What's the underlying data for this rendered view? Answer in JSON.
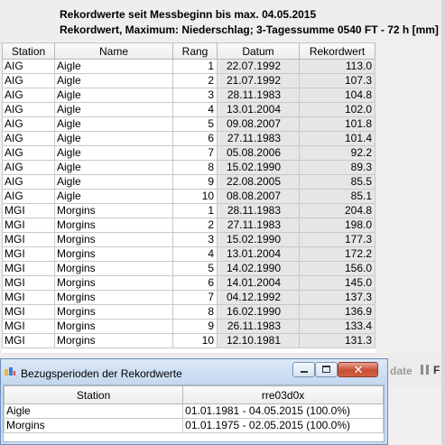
{
  "main": {
    "title": "Rekordwerte seit Messbeginn bis max. 04.05.2015",
    "subtitle": "Rekordwert, Maximum: Niederschlag; 3-Tagessumme 0540 FT - 72 h [mm]",
    "columns": [
      "Station",
      "Name",
      "Rang",
      "Datum",
      "Rekordwert"
    ],
    "rows": [
      {
        "station": "AIG",
        "name": "Aigle",
        "rank": "1",
        "date": "22.07.1992",
        "value": "113.0"
      },
      {
        "station": "AIG",
        "name": "Aigle",
        "rank": "2",
        "date": "21.07.1992",
        "value": "107.3"
      },
      {
        "station": "AIG",
        "name": "Aigle",
        "rank": "3",
        "date": "28.11.1983",
        "value": "104.8"
      },
      {
        "station": "AIG",
        "name": "Aigle",
        "rank": "4",
        "date": "13.01.2004",
        "value": "102.0"
      },
      {
        "station": "AIG",
        "name": "Aigle",
        "rank": "5",
        "date": "09.08.2007",
        "value": "101.8"
      },
      {
        "station": "AIG",
        "name": "Aigle",
        "rank": "6",
        "date": "27.11.1983",
        "value": "101.4"
      },
      {
        "station": "AIG",
        "name": "Aigle",
        "rank": "7",
        "date": "05.08.2006",
        "value": "92.2"
      },
      {
        "station": "AIG",
        "name": "Aigle",
        "rank": "8",
        "date": "15.02.1990",
        "value": "89.3"
      },
      {
        "station": "AIG",
        "name": "Aigle",
        "rank": "9",
        "date": "22.08.2005",
        "value": "85.5"
      },
      {
        "station": "AIG",
        "name": "Aigle",
        "rank": "10",
        "date": "08.08.2007",
        "value": "85.1"
      },
      {
        "station": "MGI",
        "name": "Morgins",
        "rank": "1",
        "date": "28.11.1983",
        "value": "204.8"
      },
      {
        "station": "MGI",
        "name": "Morgins",
        "rank": "2",
        "date": "27.11.1983",
        "value": "198.0"
      },
      {
        "station": "MGI",
        "name": "Morgins",
        "rank": "3",
        "date": "15.02.1990",
        "value": "177.3"
      },
      {
        "station": "MGI",
        "name": "Morgins",
        "rank": "4",
        "date": "13.01.2004",
        "value": "172.2"
      },
      {
        "station": "MGI",
        "name": "Morgins",
        "rank": "5",
        "date": "14.02.1990",
        "value": "156.0"
      },
      {
        "station": "MGI",
        "name": "Morgins",
        "rank": "6",
        "date": "14.01.2004",
        "value": "145.0"
      },
      {
        "station": "MGI",
        "name": "Morgins",
        "rank": "7",
        "date": "04.12.1992",
        "value": "137.3"
      },
      {
        "station": "MGI",
        "name": "Morgins",
        "rank": "8",
        "date": "16.02.1990",
        "value": "136.9"
      },
      {
        "station": "MGI",
        "name": "Morgins",
        "rank": "9",
        "date": "26.11.1983",
        "value": "133.4"
      },
      {
        "station": "MGI",
        "name": "Morgins",
        "rank": "10",
        "date": "12.10.1981",
        "value": "131.3"
      }
    ],
    "toolbar": {
      "update_label": "date",
      "pause_icon": "pause-icon",
      "partial_label": "F"
    }
  },
  "dialog": {
    "title": "Bezugsperioden der Rekordwerte",
    "icon": "app-icon",
    "columns": [
      "Station",
      "rre03d0x"
    ],
    "rows": [
      {
        "station": "Aigle",
        "period": "01.01.1981 - 04.05.2015 (100.0%)"
      },
      {
        "station": "Morgins",
        "period": "01.01.1975 - 02.05.2015 (100.0%)"
      }
    ],
    "buttons": {
      "minimize_icon": "minimize-icon",
      "maximize_icon": "maximize-icon",
      "close_icon": "close-icon",
      "close_glyph": "✕"
    }
  },
  "colors": {
    "grey_cell": "#e6e6e6",
    "dialog_frame": "#c9dcf2",
    "close_button": "#c74f36"
  }
}
